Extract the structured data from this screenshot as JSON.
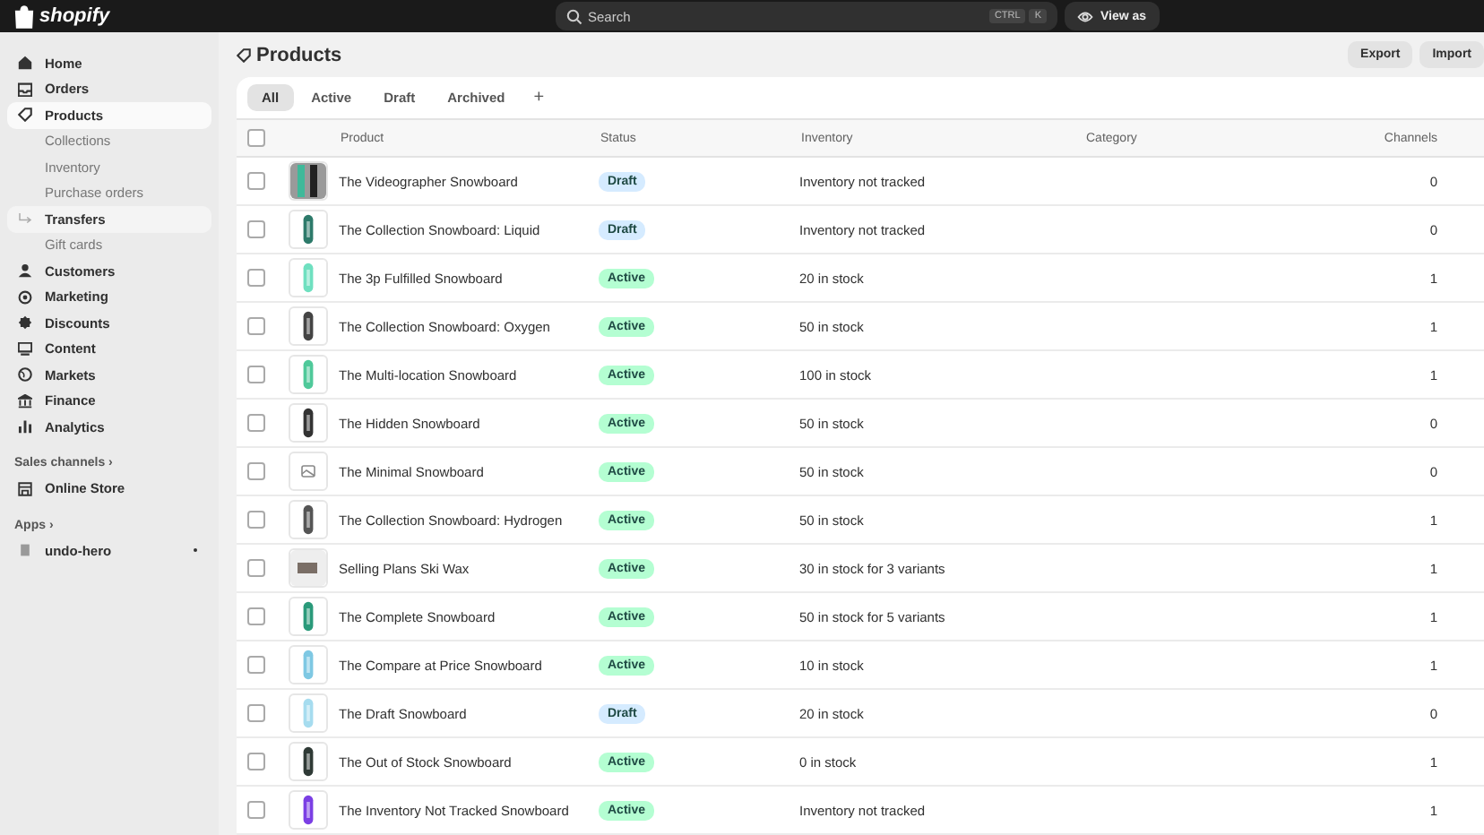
{
  "topbar": {
    "logo": "shopify",
    "search": {
      "placeholder": "Search",
      "keys": [
        "CTRL",
        "K"
      ]
    },
    "view_as": "View as"
  },
  "sidebar": {
    "items": [
      {
        "label": "Home",
        "kind": "home",
        "selected": false
      },
      {
        "label": "Orders",
        "kind": "inbox",
        "selected": false
      },
      {
        "label": "Products",
        "kind": "tag",
        "selected": true,
        "children": [
          {
            "label": "Collections",
            "highlighted": false,
            "arrow": false
          },
          {
            "label": "Inventory",
            "highlighted": false,
            "arrow": false
          },
          {
            "label": "Purchase orders",
            "highlighted": false,
            "arrow": false
          },
          {
            "label": "Transfers",
            "highlighted": true,
            "arrow": true
          },
          {
            "label": "Gift cards",
            "highlighted": false,
            "arrow": false
          }
        ]
      },
      {
        "label": "Customers",
        "kind": "person",
        "selected": false
      },
      {
        "label": "Marketing",
        "kind": "target",
        "selected": false
      },
      {
        "label": "Discounts",
        "kind": "discount",
        "selected": false
      },
      {
        "label": "Content",
        "kind": "content",
        "selected": false
      },
      {
        "label": "Markets",
        "kind": "globe",
        "selected": false
      },
      {
        "label": "Finance",
        "kind": "bank",
        "selected": false
      },
      {
        "label": "Analytics",
        "kind": "bars",
        "selected": false
      }
    ],
    "sections": [
      {
        "title": "Sales channels",
        "chevron": "›",
        "items": [
          {
            "label": "Online Store",
            "kind": "store",
            "dot": false
          }
        ]
      },
      {
        "title": "Apps",
        "chevron": "›",
        "items": [
          {
            "label": "undo-hero",
            "kind": "app",
            "dot": true
          }
        ]
      }
    ]
  },
  "page": {
    "title": "Products",
    "actions": [
      "Export",
      "Import"
    ]
  },
  "tabs": [
    {
      "label": "All",
      "selected": true
    },
    {
      "label": "Active",
      "selected": false
    },
    {
      "label": "Draft",
      "selected": false
    },
    {
      "label": "Archived",
      "selected": false
    }
  ],
  "add_tab": "+",
  "table": {
    "all_checked": false,
    "columns": [
      "Product",
      "Status",
      "Inventory",
      "Category",
      "Channels"
    ],
    "rows": [
      {
        "checked": false,
        "thumb": {
          "kind": "photo"
        },
        "product": "The Videographer Snowboard",
        "status": {
          "label": "Draft",
          "color": "#d5ebff"
        },
        "inventory": "Inventory not tracked",
        "channels": "0"
      },
      {
        "checked": false,
        "thumb": {
          "kind": "board",
          "color": "#2d7a6a"
        },
        "product": "The Collection Snowboard: Liquid",
        "status": {
          "label": "Draft",
          "color": "#d5ebff"
        },
        "inventory": "Inventory not tracked",
        "channels": "0"
      },
      {
        "checked": false,
        "thumb": {
          "kind": "board",
          "color": "#6fe0c0"
        },
        "product": "The 3p Fulfilled Snowboard",
        "status": {
          "label": "Active",
          "color": "#b4fed2"
        },
        "inventory": "20 in stock",
        "channels": "1"
      },
      {
        "checked": false,
        "thumb": {
          "kind": "board",
          "color": "#444444"
        },
        "product": "The Collection Snowboard: Oxygen",
        "status": {
          "label": "Active",
          "color": "#b4fed2"
        },
        "inventory": "50 in stock",
        "channels": "1"
      },
      {
        "checked": false,
        "thumb": {
          "kind": "board",
          "color": "#4fc99a"
        },
        "product": "The Multi-location Snowboard",
        "status": {
          "label": "Active",
          "color": "#b4fed2"
        },
        "inventory": "100 in stock",
        "channels": "1"
      },
      {
        "checked": false,
        "thumb": {
          "kind": "board",
          "color": "#333333"
        },
        "product": "The Hidden Snowboard",
        "status": {
          "label": "Active",
          "color": "#b4fed2"
        },
        "inventory": "50 in stock",
        "channels": "0"
      },
      {
        "checked": false,
        "thumb": {
          "kind": "placeholder"
        },
        "product": "The Minimal Snowboard",
        "status": {
          "label": "Active",
          "color": "#b4fed2"
        },
        "inventory": "50 in stock",
        "channels": "0"
      },
      {
        "checked": false,
        "thumb": {
          "kind": "board",
          "color": "#555555"
        },
        "product": "The Collection Snowboard: Hydrogen",
        "status": {
          "label": "Active",
          "color": "#b4fed2"
        },
        "inventory": "50 in stock",
        "channels": "1"
      },
      {
        "checked": false,
        "thumb": {
          "kind": "wax"
        },
        "product": "Selling Plans Ski Wax",
        "status": {
          "label": "Active",
          "color": "#b4fed2"
        },
        "inventory": "30 in stock for 3 variants",
        "channels": "1"
      },
      {
        "checked": false,
        "thumb": {
          "kind": "board",
          "color": "#2a9a7a"
        },
        "product": "The Complete Snowboard",
        "status": {
          "label": "Active",
          "color": "#b4fed2"
        },
        "inventory": "50 in stock for 5 variants",
        "channels": "1"
      },
      {
        "checked": false,
        "thumb": {
          "kind": "board",
          "color": "#7ec8e3"
        },
        "product": "The Compare at Price Snowboard",
        "status": {
          "label": "Active",
          "color": "#b4fed2"
        },
        "inventory": "10 in stock",
        "channels": "1"
      },
      {
        "checked": false,
        "thumb": {
          "kind": "board",
          "color": "#a6dcef"
        },
        "product": "The Draft Snowboard",
        "status": {
          "label": "Draft",
          "color": "#d5ebff"
        },
        "inventory": "20 in stock",
        "channels": "0"
      },
      {
        "checked": false,
        "thumb": {
          "kind": "board",
          "color": "#2f3a36"
        },
        "product": "The Out of Stock Snowboard",
        "status": {
          "label": "Active",
          "color": "#b4fed2"
        },
        "inventory": "0 in stock",
        "channels": "1"
      },
      {
        "checked": false,
        "thumb": {
          "kind": "board",
          "color": "#7b3fe4"
        },
        "product": "The Inventory Not Tracked Snowboard",
        "status": {
          "label": "Active",
          "color": "#b4fed2"
        },
        "inventory": "Inventory not tracked",
        "channels": "1"
      }
    ]
  }
}
